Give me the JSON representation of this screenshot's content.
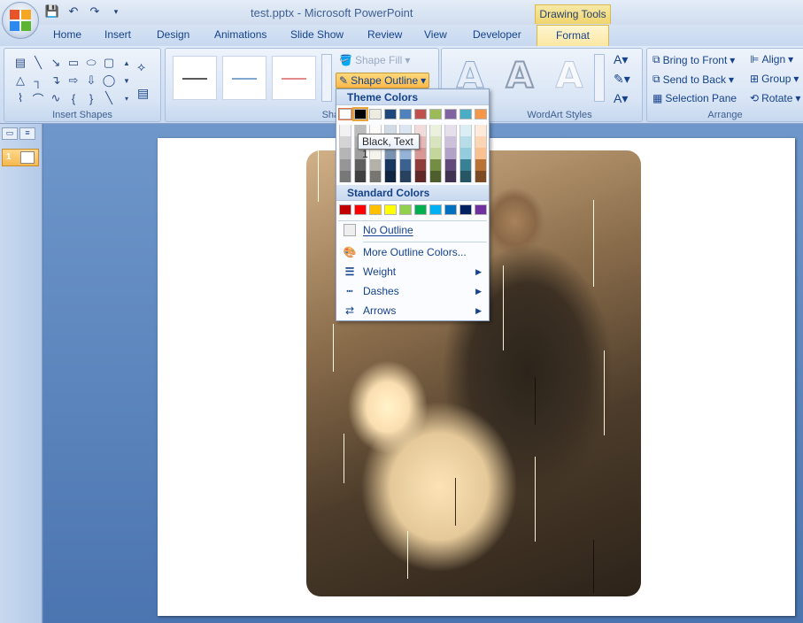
{
  "window": {
    "title": "test.pptx - Microsoft PowerPoint",
    "contextual_tab_group": "Drawing Tools"
  },
  "tabs": [
    {
      "label": "Home"
    },
    {
      "label": "Insert"
    },
    {
      "label": "Design"
    },
    {
      "label": "Animations"
    },
    {
      "label": "Slide Show"
    },
    {
      "label": "Review"
    },
    {
      "label": "View"
    },
    {
      "label": "Developer"
    },
    {
      "label": "Format",
      "active": true
    }
  ],
  "ribbon": {
    "insert_shapes": {
      "label": "Insert Shapes"
    },
    "shape_styles": {
      "label": "Shape Styles",
      "shape_fill": "Shape Fill",
      "shape_outline": "Shape Outline",
      "style_colors": [
        "#5a5a5a",
        "#7fa7d0",
        "#e38b8b"
      ]
    },
    "wordart_styles": {
      "label": "WordArt Styles",
      "glyph": "A"
    },
    "arrange": {
      "label": "Arrange",
      "bring_to_front": "Bring to Front",
      "send_to_back": "Send to Back",
      "selection_pane": "Selection Pane",
      "align": "Align",
      "group": "Group",
      "rotate": "Rotate"
    }
  },
  "slides_panel": {
    "slide_number": "1"
  },
  "outline_menu": {
    "theme_colors_header": "Theme Colors",
    "standard_colors_header": "Standard Colors",
    "tooltip": "Black, Text 1",
    "theme_colors": [
      "#ffffff",
      "#000000",
      "#eeece1",
      "#1f497d",
      "#4f81bd",
      "#c0504d",
      "#9bbb59",
      "#8064a2",
      "#4bacc6",
      "#f79646"
    ],
    "standard_colors": [
      "#c00000",
      "#ff0000",
      "#ffc000",
      "#ffff00",
      "#92d050",
      "#00b050",
      "#00b0f0",
      "#0070c0",
      "#002060",
      "#7030a0"
    ],
    "items": {
      "no_outline": "No Outline",
      "more_colors": "More Outline Colors...",
      "weight": "Weight",
      "dashes": "Dashes",
      "arrows": "Arrows"
    }
  }
}
